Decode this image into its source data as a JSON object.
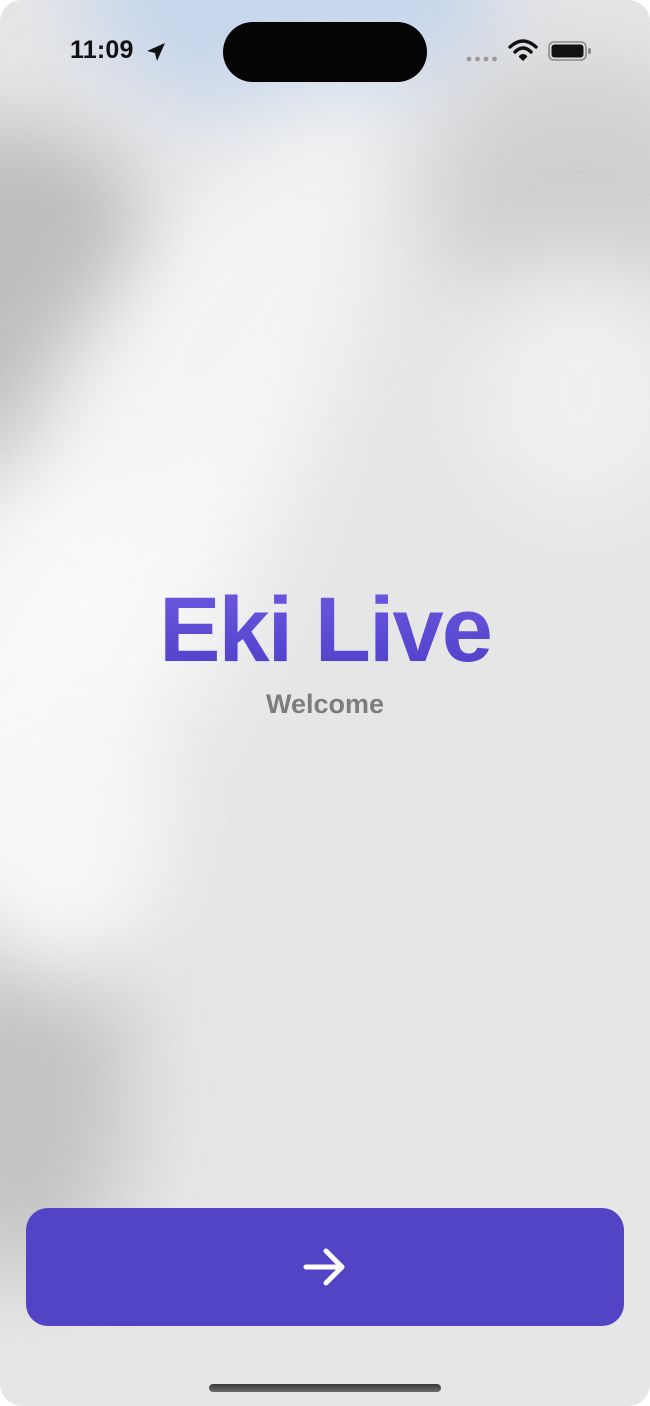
{
  "status_bar": {
    "time": "11:09",
    "icons": [
      "location-arrow-icon",
      "cellular-signal-icon",
      "wifi-icon",
      "battery-icon"
    ]
  },
  "main": {
    "title": "Eki Live",
    "subtitle": "Welcome"
  },
  "continue_button": {
    "icon": "arrow-right-icon"
  },
  "colors": {
    "accent": "#5245c5",
    "title_gradient_top": "#6d5ae0",
    "title_gradient_bottom": "#4e3ec9",
    "subtitle": "#7d7d80",
    "background": "#e6e6e7"
  }
}
